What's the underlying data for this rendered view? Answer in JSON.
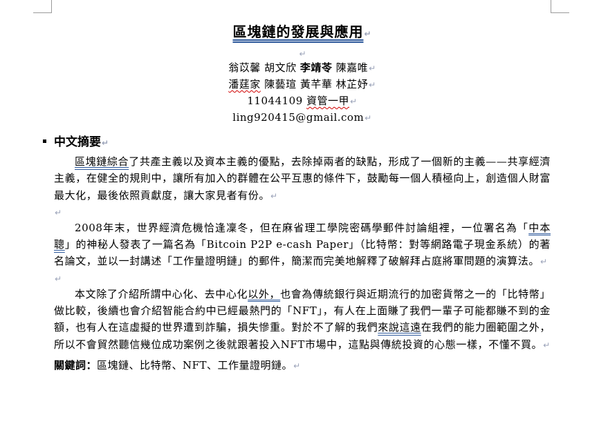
{
  "document": {
    "title": "區塊鏈的發展與應用",
    "paragraph_mark": "↵",
    "authors_line1": [
      {
        "name": "翁苡馨",
        "bold": false
      },
      {
        "name": "胡文欣",
        "bold": false
      },
      {
        "name": "李靖苓",
        "bold": true
      },
      {
        "name": "陳嘉唯",
        "bold": false
      }
    ],
    "authors_line2": [
      {
        "name": "潘莛家",
        "bold": false
      },
      {
        "name": "陳藝瑄",
        "bold": false
      },
      {
        "name": "黃芊華",
        "bold": false
      },
      {
        "name": "林芷妤",
        "bold": false
      }
    ],
    "student_id": "11044109",
    "class_name": "資管一甲",
    "email": "ling920415@gmail.com",
    "section_heading": "中文摘要",
    "para1": {
      "term": "區塊鏈綜合",
      "rest": "了共產主義以及資本主義的優點，去除掉兩者的缺點，形成了一個新的主義——共享經濟主義，在健全的規則中，讓所有加入的群體在公平互惠的條件下，鼓勵每一個人積極向上，創造個人財富最大化，最後依照貢獻度，讓大家見者有份。"
    },
    "para2": {
      "a": "2008年末，世界經濟危機恰逢凜冬，但在麻省理工學院密碼學郵件討論組裡，一位署名為「",
      "name": "中本聰",
      "b": "」的神秘人發表了一篇名為「Bitcoin P2P e-cash Paper」（比特幣：對等網路電子現金系統）的著名論文，並以一封講述「工作量證明鏈」的郵件，簡潔而完美地解釋了破解拜占庭將軍問題的演算法。"
    },
    "para3": {
      "a": "本文除了介紹所謂中心化、去中心化",
      "b": "以外，",
      "c": "也會為傳統銀行與近期流行的加密貨幣之一的「比特幣」做比較，後續也會介紹智能合約中已經最熱門的「NFT」，有人在上面賺了我們一輩子可能都賺不到的金額，也有人在這虛擬的世界遭到詐騙，損失慘重。對於不了解的我們",
      "d": "來說這遠",
      "e": "在我們的能力圈範圍之外，所以不會貿然聽信幾位成功案例之後就跟著投入NFT市場中，這點與傳統投資的心態一樣，不懂不買。"
    },
    "keywords_label": "關鍵詞：",
    "keywords": "區塊鏈、比特幣、NFT、工作量證明鏈。"
  }
}
